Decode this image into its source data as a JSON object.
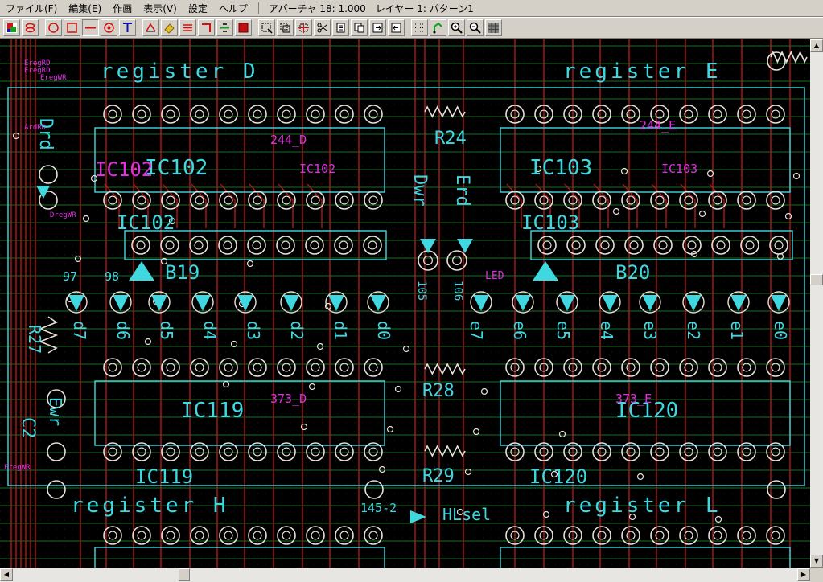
{
  "menu": {
    "items": [
      "ファイル(F)",
      "編集(E)",
      "作画",
      "表示(V)",
      "設定",
      "ヘルプ"
    ],
    "aperture": "アパーチャ 18: 1.000",
    "layer": "レイヤー 1: パターン1"
  },
  "toolbar": {
    "buttons": [
      "layer-color",
      "pad-stack",
      "circle",
      "rectangle",
      "line",
      "ring",
      "text",
      "trace-angle",
      "eraser",
      "multi-line",
      "corner-line",
      "align-trace",
      "fill",
      "select-area",
      "copy-area",
      "move-area",
      "cut",
      "paste",
      "paste-move",
      "export",
      "import",
      "grid-snap",
      "route",
      "zoom-in",
      "zoom-out",
      "grid"
    ]
  },
  "colors": {
    "background": "#000000",
    "cyan": "#40d8e0",
    "magenta": "#e030e0",
    "copper": "#e8e0d8",
    "red_trace": "#c01818",
    "green_grid": "#1a7a2a"
  },
  "board": {
    "labels_large": [
      "register D",
      "register E",
      "register H",
      "register L"
    ],
    "ics": [
      "IC102",
      "IC103",
      "IC119",
      "IC120"
    ],
    "ic_parts_top": [
      "244_D",
      "244_E"
    ],
    "ic_parts_bottom": [
      "373_D",
      "373_E"
    ],
    "resistors": [
      "R24",
      "R28",
      "R29",
      "R27"
    ],
    "buttons": [
      "B19",
      "B20"
    ],
    "magenta_signals": [
      "EregRD",
      "EregRD",
      "EregWR",
      "ArdRD",
      "DregWR",
      "EregWR"
    ],
    "bit_labels_left": [
      "d7",
      "d6",
      "d5",
      "d4",
      "d3",
      "d2",
      "d1",
      "d0"
    ],
    "bit_labels_right": [
      "e7",
      "e6",
      "e5",
      "e4",
      "e3",
      "e2",
      "e1",
      "e0"
    ],
    "misc": [
      "Dwr",
      "Erd",
      "Drd",
      "Ewr",
      "C2",
      "HLsel",
      "145-2",
      "97",
      "98",
      "105",
      "106",
      "LED"
    ]
  }
}
